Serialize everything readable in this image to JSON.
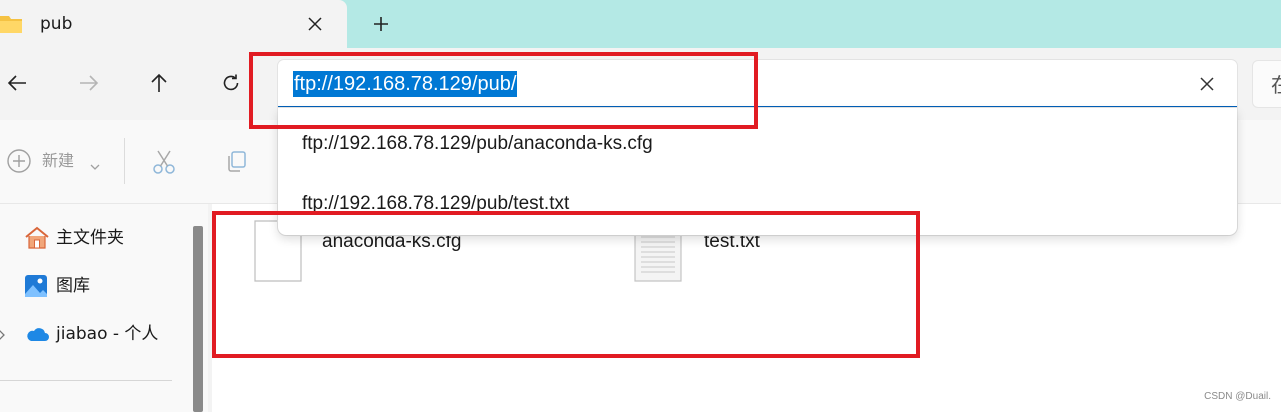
{
  "tab": {
    "title": "pub",
    "folder_icon": "folder-icon",
    "close_icon": "close-icon",
    "new_tab_icon": "plus-icon"
  },
  "nav": {
    "back_icon": "arrow-left-icon",
    "forward_icon": "arrow-right-icon",
    "up_icon": "arrow-up-icon",
    "refresh_icon": "refresh-icon"
  },
  "address": {
    "value": "ftp://192.168.78.129/pub/",
    "clear_icon": "close-icon"
  },
  "search": {
    "text": "在"
  },
  "suggestions": [
    "ftp://192.168.78.129/pub/anaconda-ks.cfg",
    "ftp://192.168.78.129/pub/test.txt"
  ],
  "toolbar": {
    "new_label": "新建",
    "cut_icon": "scissors-icon",
    "copy_icon": "copy-icon"
  },
  "sidebar": {
    "items": [
      {
        "label": "主文件夹",
        "icon": "home-icon"
      },
      {
        "label": "图库",
        "icon": "gallery-icon"
      },
      {
        "label": "jiabao - 个人",
        "icon": "cloud-icon",
        "expandable": true
      }
    ]
  },
  "files": [
    {
      "name": "anaconda-ks.cfg",
      "icon": "blank-file-icon"
    },
    {
      "name": "test.txt",
      "icon": "text-file-icon"
    }
  ],
  "watermark": "CSDN @Duail.",
  "colors": {
    "tabbar_bg": "#b4e9e5",
    "selection": "#0078d4",
    "annotation": "#e11b22"
  }
}
